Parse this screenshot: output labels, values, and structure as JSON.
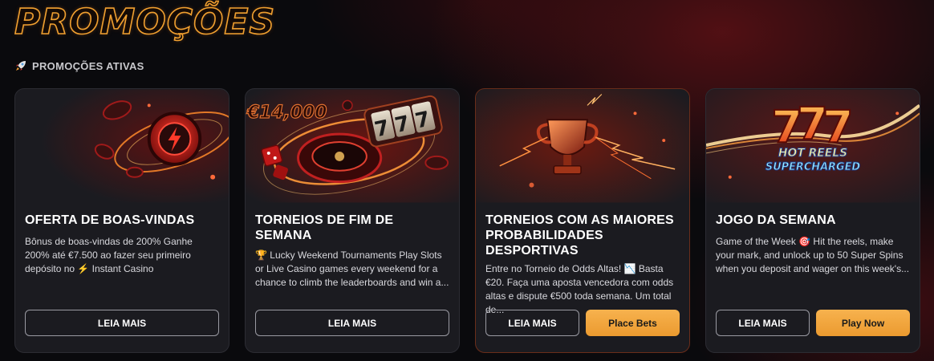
{
  "page": {
    "title": "PROMOÇÕES",
    "section_label": "PROMOÇÕES ATIVAS",
    "accent": "#f0a030"
  },
  "cards": [
    {
      "title": "OFERTA DE BOAS-VINDAS",
      "desc": "Bônus de boas-vindas de 200% Ganhe 200% até €7.500 ao fazer seu primeiro depósito no ⚡ Instant Casino",
      "btn_read": "LEIA MAIS"
    },
    {
      "title": "TORNEIOS DE FIM DE SEMANA",
      "art_text": "€14,000",
      "art_slot": "777",
      "desc": "🏆 Lucky Weekend Tournaments Play Slots or Live Casino games every weekend for a chance to climb the leaderboards and win a...",
      "btn_read": "LEIA MAIS"
    },
    {
      "title": "TORNEIOS COM AS MAIORES PROBABILIDADES DESPORTIVAS",
      "desc": "Entre no Torneio de Odds Altas! 📉 Basta €20. Faça uma aposta vencedora com odds altas e dispute €500 toda semana. Um total de...",
      "btn_read": "LEIA MAIS",
      "btn_action": "Place Bets"
    },
    {
      "title": "JOGO DA SEMANA",
      "art_line1": "HOT REELS",
      "art_line2": "SUPERCHARGED",
      "desc": "Game of the Week 🎯 Hit the reels, make your mark, and unlock up to 50 Super Spins when you deposit and wager on this week's...",
      "btn_read": "LEIA MAIS",
      "btn_action": "Play Now"
    }
  ]
}
